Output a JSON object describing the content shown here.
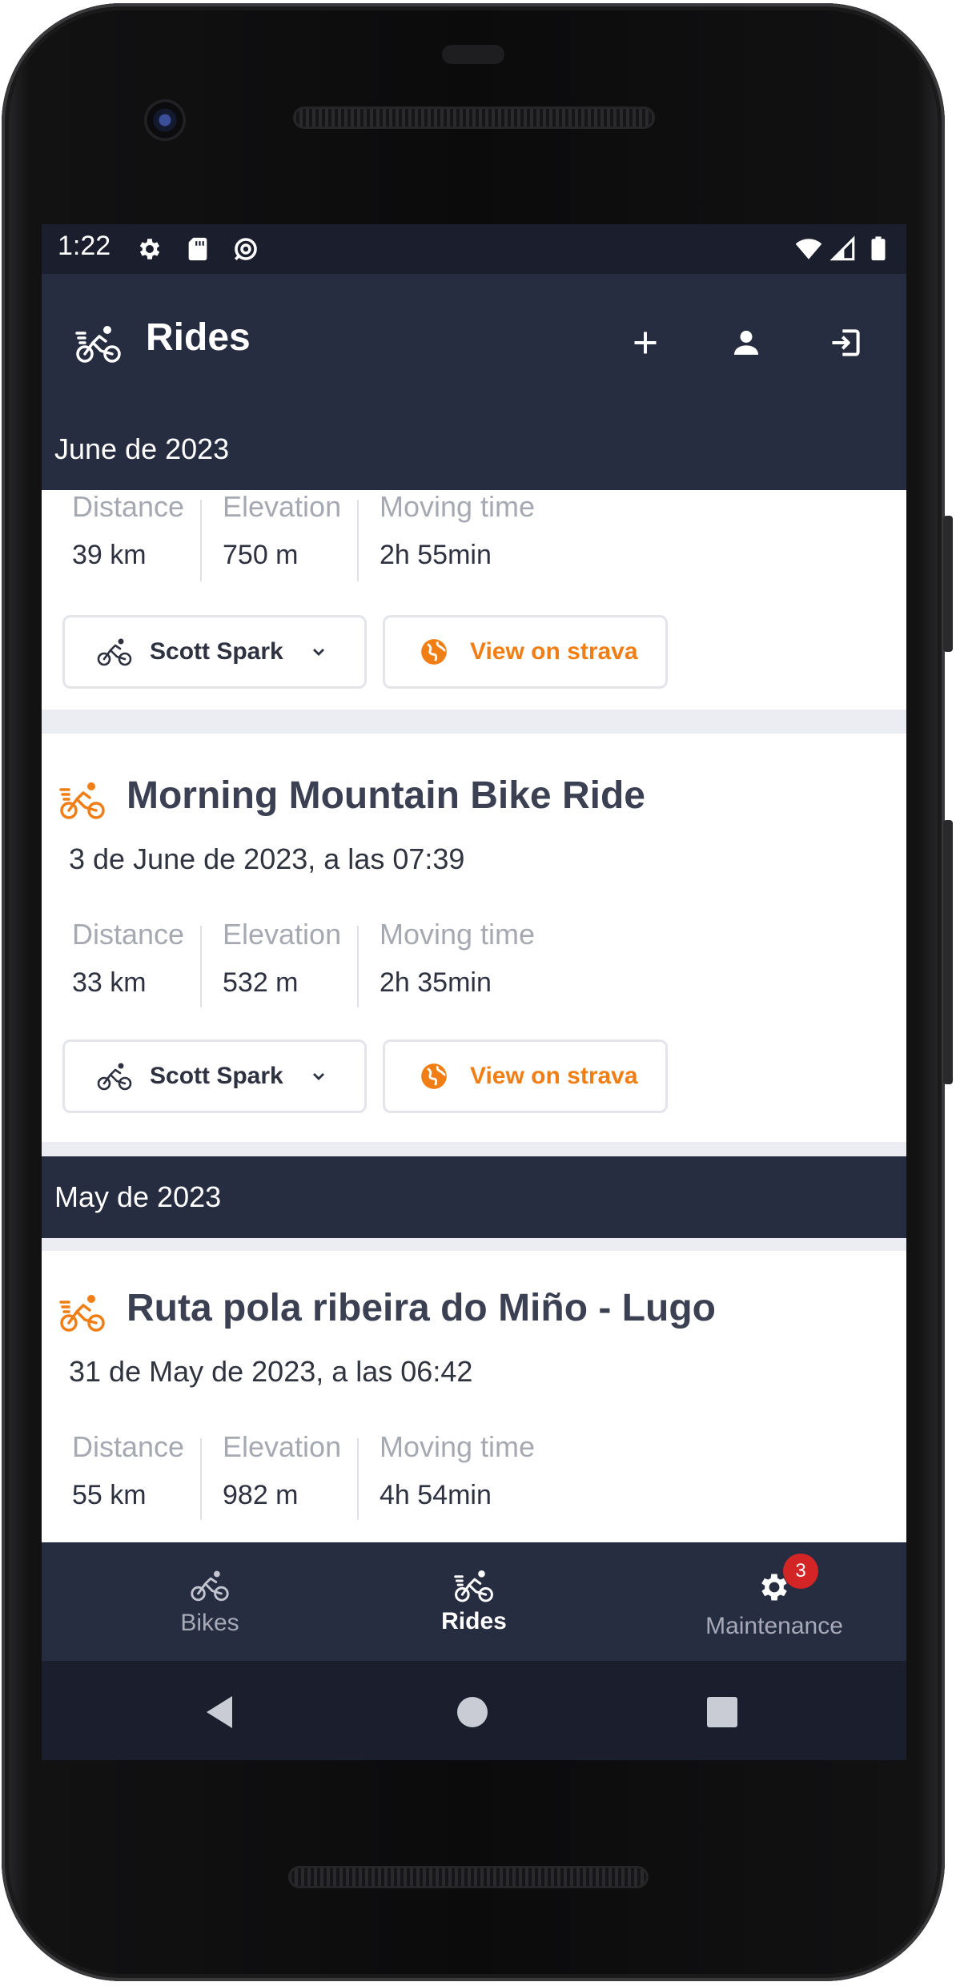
{
  "status_bar": {
    "time": "1:22"
  },
  "app_bar": {
    "title": "Rides",
    "icons": [
      "bike-rider-icon",
      "add-icon",
      "person-icon",
      "logout-icon"
    ]
  },
  "months": [
    {
      "label": "June de 2023"
    },
    {
      "label": "May de 2023"
    }
  ],
  "stat_labels": {
    "distance": "Distance",
    "elevation": "Elevation",
    "moving_time": "Moving time"
  },
  "rides": [
    {
      "title": "",
      "date": "",
      "distance": "39 km",
      "elevation": "750 m",
      "moving_time": "2h 55min",
      "bike": "Scott Spark",
      "strava_label": "View on strava"
    },
    {
      "title": "Morning Mountain Bike Ride",
      "date": "3 de June de 2023, a las 07:39",
      "distance": "33 km",
      "elevation": "532 m",
      "moving_time": "2h 35min",
      "bike": "Scott Spark",
      "strava_label": "View on strava"
    },
    {
      "title": "Ruta pola ribeira do Miño - Lugo",
      "date": "31 de May de 2023, a las 06:42",
      "distance": "55 km",
      "elevation": "982 m",
      "moving_time": "4h 54min"
    }
  ],
  "bottom_nav": {
    "items": [
      {
        "label": "Bikes",
        "active": false
      },
      {
        "label": "Rides",
        "active": true
      },
      {
        "label": "Maintenance",
        "active": false,
        "badge": "3"
      }
    ]
  },
  "colors": {
    "primary_dark": "#272d41",
    "accent_orange": "#f07e14",
    "badge_red": "#d32525",
    "background": "#ebedf3"
  }
}
